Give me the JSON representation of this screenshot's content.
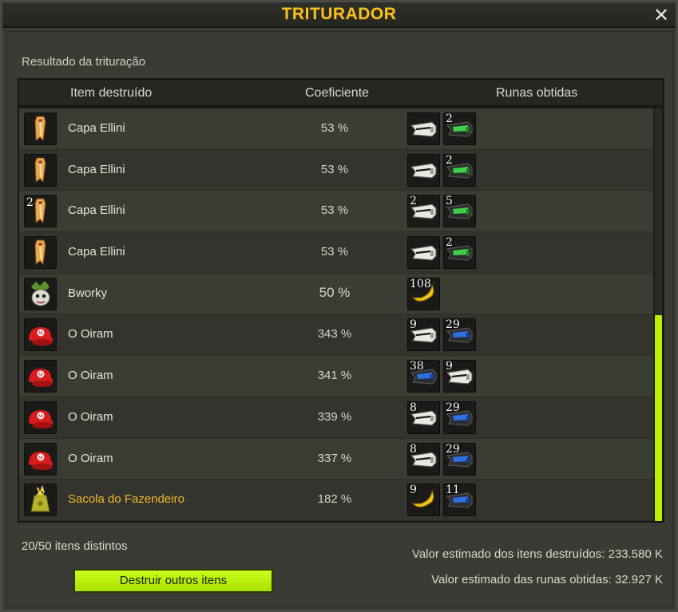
{
  "window": {
    "title": "TRITURADOR",
    "close_glyph": "✕"
  },
  "section_label": "Resultado da trituração",
  "table": {
    "headers": {
      "item": "Item destruído",
      "coefficient": "Coeficiente",
      "runes": "Runas obtidas"
    },
    "rows": [
      {
        "item_qty": "",
        "item_icon": "cape-icon",
        "name": "Capa Ellini",
        "coefficient": "53 %",
        "runes": [
          {
            "qty": "",
            "icon": "white-rune-icon"
          },
          {
            "qty": "2",
            "icon": "green-rune-icon"
          }
        ]
      },
      {
        "item_qty": "",
        "item_icon": "cape-icon",
        "name": "Capa Ellini",
        "coefficient": "53 %",
        "runes": [
          {
            "qty": "",
            "icon": "white-rune-icon"
          },
          {
            "qty": "2",
            "icon": "green-rune-icon"
          }
        ]
      },
      {
        "item_qty": "2",
        "item_icon": "cape-icon",
        "name": "Capa Ellini",
        "coefficient": "53 %",
        "runes": [
          {
            "qty": "2",
            "icon": "white-rune-icon"
          },
          {
            "qty": "5",
            "icon": "green-rune-icon"
          }
        ]
      },
      {
        "item_qty": "",
        "item_icon": "cape-icon",
        "name": "Capa Ellini",
        "coefficient": "53 %",
        "runes": [
          {
            "qty": "",
            "icon": "white-rune-icon"
          },
          {
            "qty": "2",
            "icon": "green-rune-icon"
          }
        ]
      },
      {
        "item_qty": "",
        "item_icon": "bworky-icon",
        "name": "Bworky",
        "coefficient": "50 %",
        "runes": [
          {
            "qty": "108",
            "icon": "yellow-rune-icon"
          }
        ]
      },
      {
        "item_qty": "",
        "item_icon": "red-cap-icon",
        "name": "O Oiram",
        "coefficient": "343 %",
        "runes": [
          {
            "qty": "9",
            "icon": "white-rune-icon"
          },
          {
            "qty": "29",
            "icon": "blue-rune-icon"
          }
        ]
      },
      {
        "item_qty": "",
        "item_icon": "red-cap-icon",
        "name": "O Oiram",
        "coefficient": "341 %",
        "runes": [
          {
            "qty": "38",
            "icon": "blue-rune-icon"
          },
          {
            "qty": "9",
            "icon": "white-rune-icon"
          }
        ]
      },
      {
        "item_qty": "",
        "item_icon": "red-cap-icon",
        "name": "O Oiram",
        "coefficient": "339 %",
        "runes": [
          {
            "qty": "8",
            "icon": "white-rune-icon"
          },
          {
            "qty": "29",
            "icon": "blue-rune-icon"
          }
        ]
      },
      {
        "item_qty": "",
        "item_icon": "red-cap-icon",
        "name": "O Oiram",
        "coefficient": "337 %",
        "runes": [
          {
            "qty": "8",
            "icon": "white-rune-icon"
          },
          {
            "qty": "29",
            "icon": "blue-rune-icon"
          }
        ]
      },
      {
        "item_qty": "",
        "item_icon": "farmer-bag-icon",
        "name": "Sacola do Fazendeiro",
        "coefficient": "182 %",
        "runes": [
          {
            "qty": "9",
            "icon": "yellow-rune-icon"
          },
          {
            "qty": "11",
            "icon": "blue-rune-icon"
          }
        ]
      }
    ]
  },
  "footer": {
    "distinct_items": "20/50 itens distintos",
    "destroy_button": "Destruir outros itens",
    "estimated_destroyed": "Valor estimado dos itens destruídos: 233.580 K",
    "estimated_runes": "Valor estimado das runas obtidas: 32.927 K"
  },
  "colors": {
    "title": "#f5c21b",
    "rare_item": "#f5b52a",
    "accent_green": "#b8f000"
  }
}
